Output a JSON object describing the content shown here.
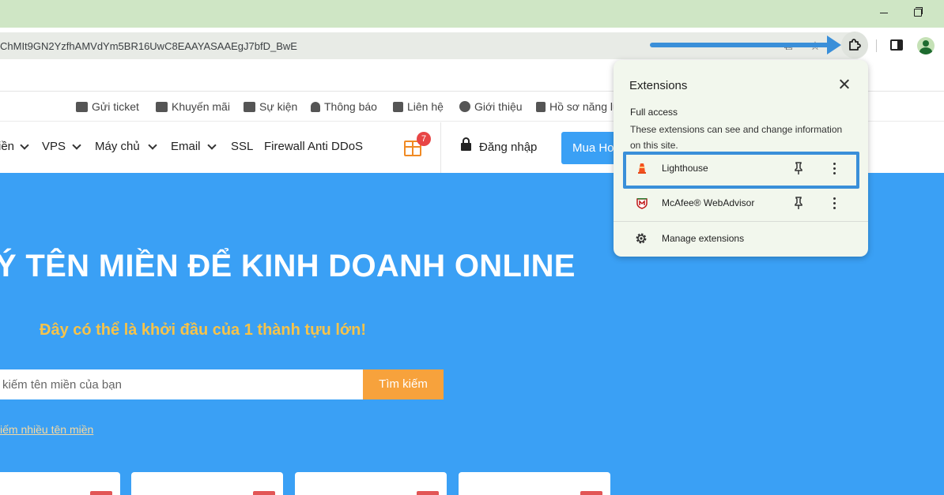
{
  "browser": {
    "url": "ChMIt9GN2YzfhAMVdYm5BR16UwC8EAAYASAAEgJ7bfD_BwE"
  },
  "site": {
    "topnav": [
      {
        "label": "Gửi ticket",
        "icon": "ticket-icon"
      },
      {
        "label": "Khuyến mãi",
        "icon": "gift-icon"
      },
      {
        "label": "Sự kiện",
        "icon": "event-icon"
      },
      {
        "label": "Thông báo",
        "icon": "bell-icon"
      },
      {
        "label": "Liên hệ",
        "icon": "contact-icon"
      },
      {
        "label": "Giới thiệu",
        "icon": "info-icon"
      },
      {
        "label": "Hồ sơ năng lự",
        "icon": "profile-doc-icon"
      }
    ],
    "menu": {
      "domain_partial": "iền",
      "vps": "VPS",
      "server": "Máy chủ",
      "email": "Email",
      "ssl": "SSL",
      "firewall": "Firewall Anti DDoS",
      "cart_count": "7",
      "login": "Đăng nhập",
      "buy": "Mua Hos"
    },
    "hero": {
      "title": "Ý TÊN MIỀN ĐỂ KINH DOANH ONLINE",
      "subtitle": "Đây có thể là khởi đầu của 1 thành tựu lớn!",
      "search_placeholder": "kiếm tên miền của bạn",
      "search_button": "Tìm kiếm",
      "multi_search_link": "iếm nhiều tên miền"
    }
  },
  "extensions_panel": {
    "title": "Extensions",
    "section_title": "Full access",
    "section_desc": "These extensions can see and change information on this site.",
    "items": [
      {
        "name": "Lighthouse",
        "icon": "lighthouse-icon",
        "color": "#f4511e"
      },
      {
        "name": "McAfee® WebAdvisor",
        "icon": "mcafee-icon",
        "color": "#c01818"
      }
    ],
    "manage_label": "Manage extensions"
  },
  "colors": {
    "titlebar": "#cfe6c5",
    "hero": "#3aa0f5",
    "accent_orange": "#f7a23c",
    "annotation_blue": "#3a8fd9",
    "panel_bg": "#f2f7ed"
  }
}
